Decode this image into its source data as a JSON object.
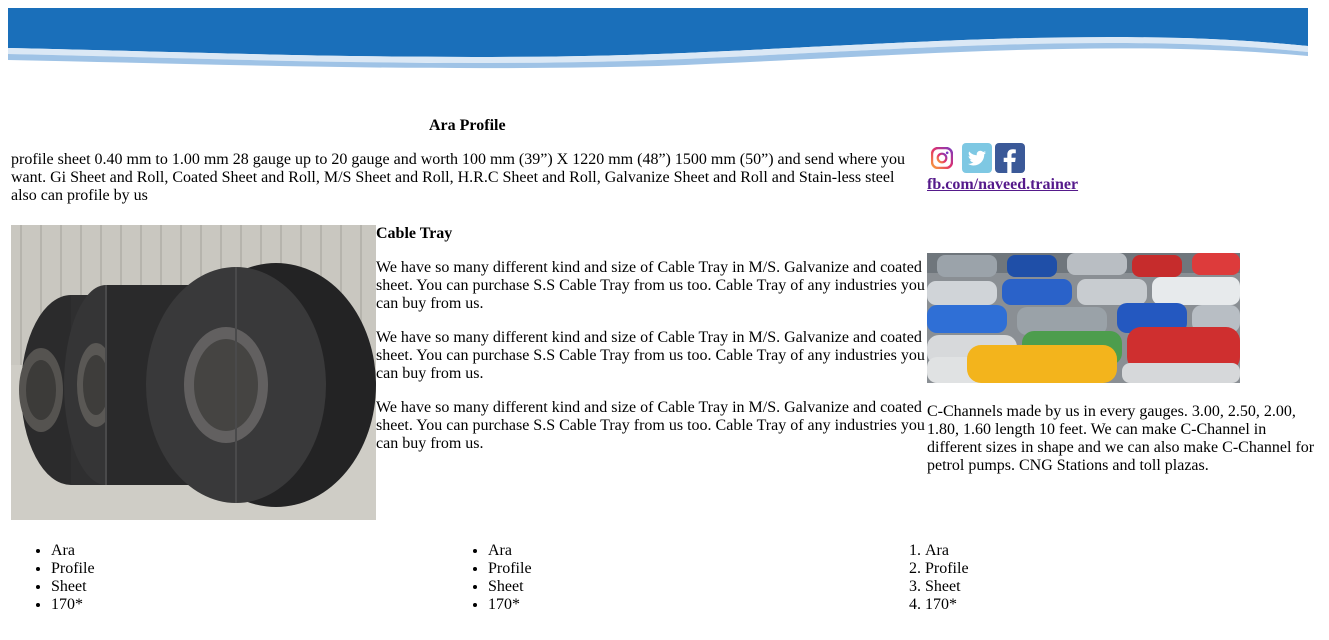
{
  "page": {
    "title": "Ara Profile",
    "intro": "profile sheet 0.40 mm to 1.00 mm 28 gauge up to 20 gauge and worth 100 mm (39”) X 1220 mm (48”) 1500 mm (50”) and send where you want. Gi Sheet and Roll, Coated Sheet and Roll, M/S Sheet and Roll, H.R.C Sheet and Roll, Galvanize Sheet and Roll and Stain-less steel also can profile by us"
  },
  "social": {
    "icons": [
      "instagram-icon",
      "twitter-icon",
      "facebook-icon"
    ],
    "link_text": "fb.com/naveed.trainer",
    "colors": {
      "twitter": "#7ec8e3",
      "facebook": "#3b5998",
      "link": "#551a8b"
    }
  },
  "middle": {
    "heading": "Cable Tray",
    "paragraphs": [
      "We have so many different kind and size of Cable Tray in M/S. Galvanize and coated sheet. You can purchase S.S Cable Tray from us too. Cable Tray of any industries you can buy from us.",
      "We have so many different kind and size of Cable Tray in M/S. Galvanize and coated sheet. You can purchase S.S Cable Tray from us too. Cable Tray of any industries you can buy from us.",
      "We have so many different kind and size of Cable Tray in M/S. Galvanize and coated sheet. You can purchase S.S Cable Tray from us too. Cable Tray of any industries you can buy from us."
    ]
  },
  "right": {
    "text": "C-Channels made by us in every gauges. 3.00, 2.50, 2.00, 1.80, 1.60 length 10 feet. We can make C-Channel in different sizes in shape and we can also make C-Channel for petrol pumps. CNG Stations and toll plazas."
  },
  "lists": [
    {
      "type": "unordered",
      "items": [
        "Ara",
        "Profile",
        "Sheet",
        "170*"
      ]
    },
    {
      "type": "unordered",
      "items": [
        "Ara",
        "Profile",
        "Sheet",
        "170*"
      ]
    },
    {
      "type": "ordered",
      "items": [
        "Ara",
        "Profile",
        "Sheet",
        "170*"
      ]
    }
  ],
  "colors": {
    "banner_blue": "#1a6fba"
  }
}
